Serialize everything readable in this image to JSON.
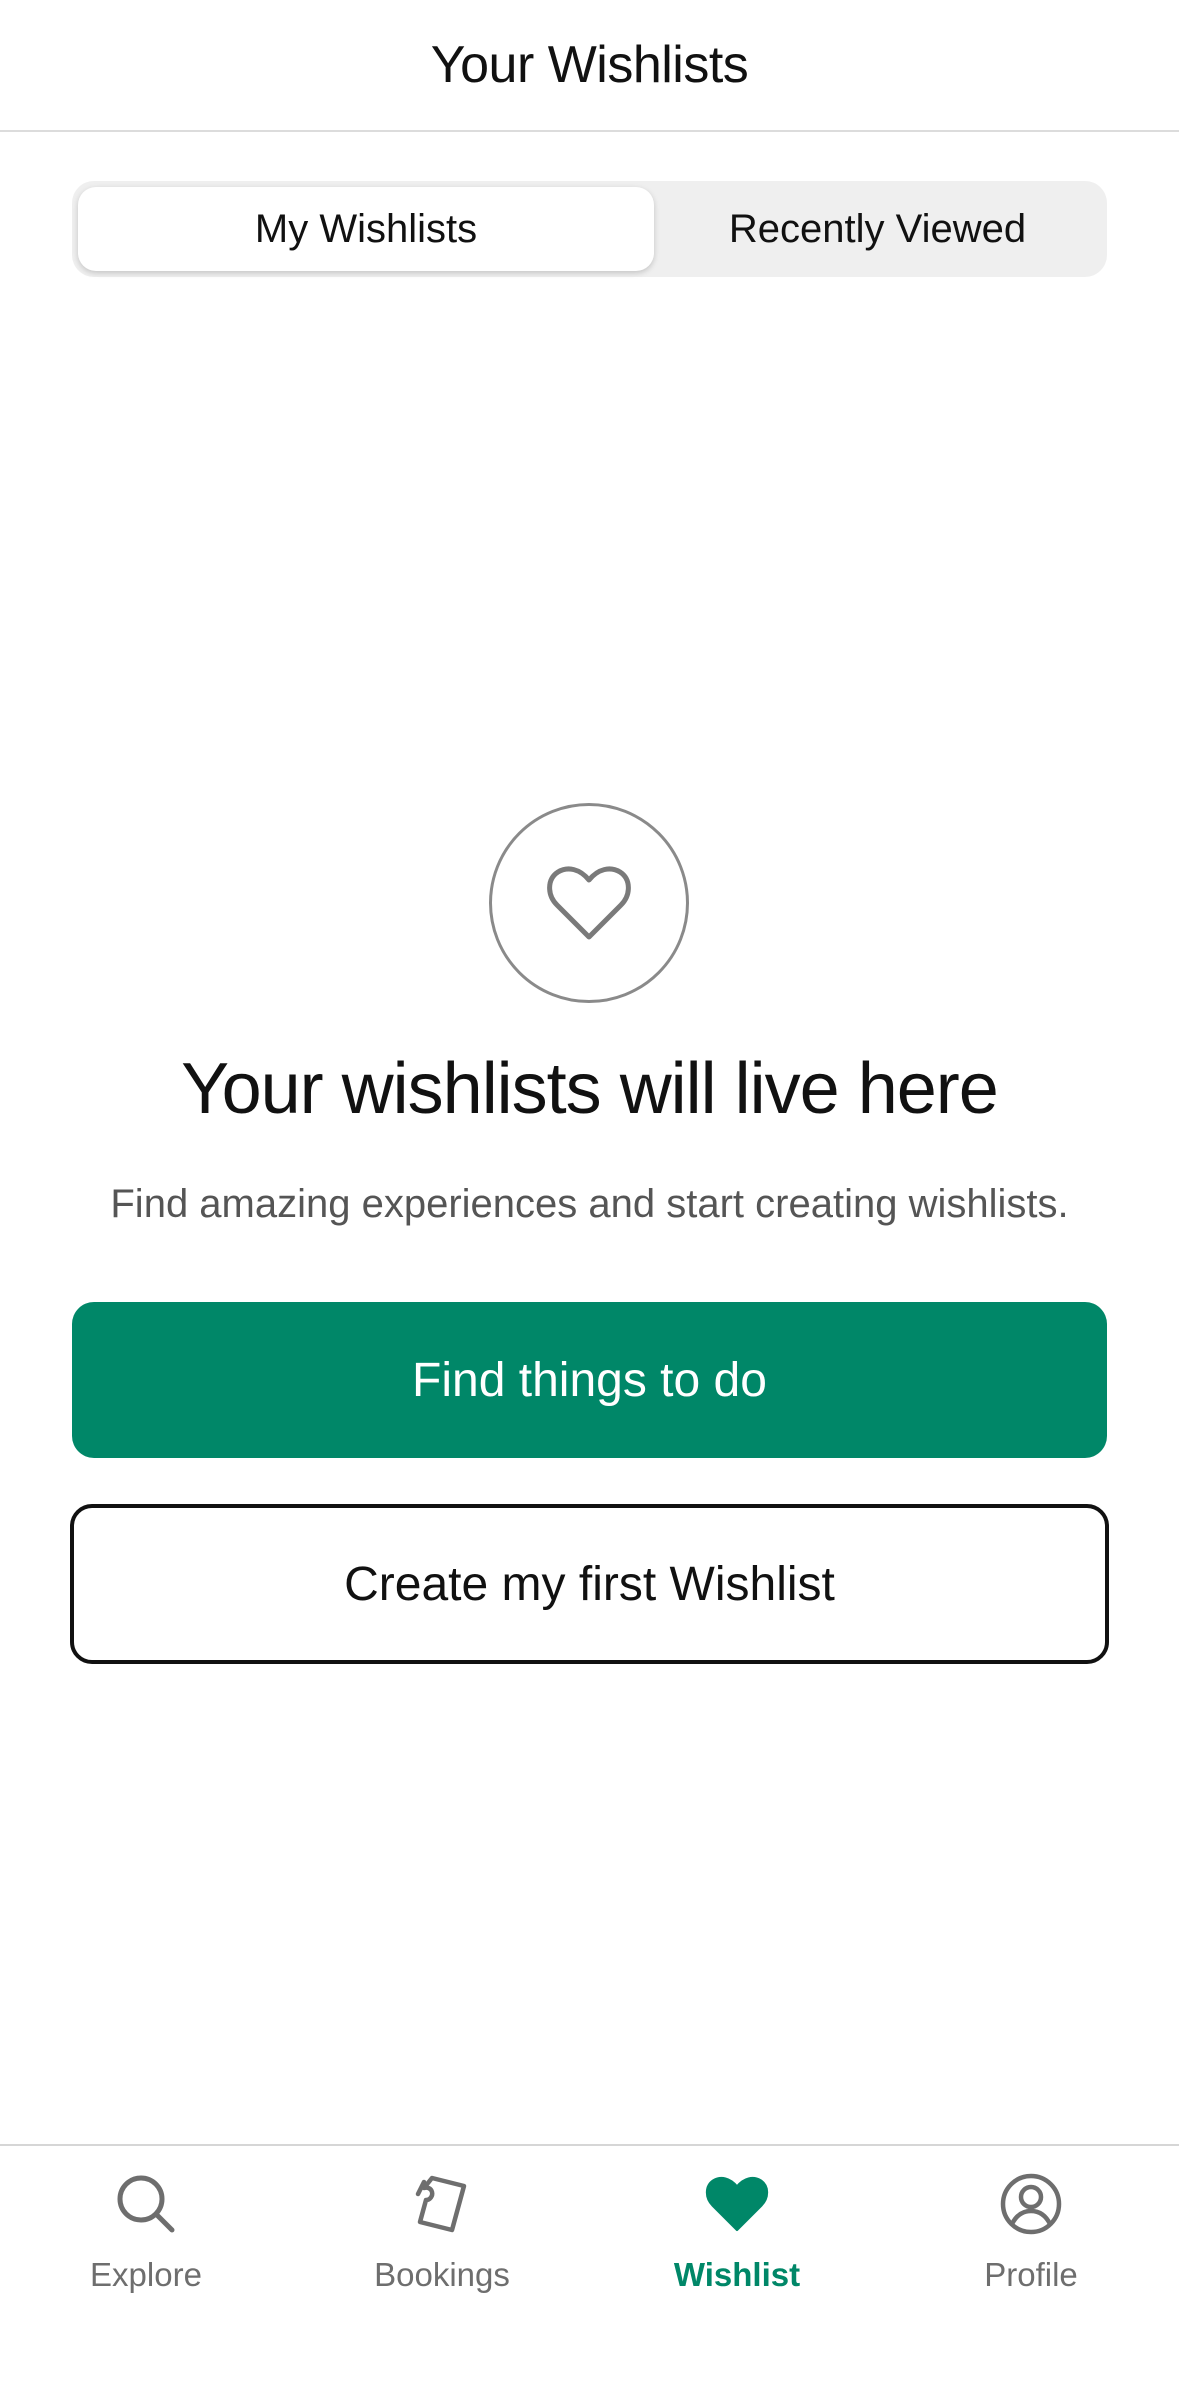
{
  "header": {
    "title": "Your Wishlists"
  },
  "segments": {
    "active": "My Wishlists",
    "inactive": "Recently Viewed"
  },
  "empty_state": {
    "icon": "heart-outline-icon",
    "title": "Your wishlists will live here",
    "subtitle": "Find amazing experiences and start creating wishlists."
  },
  "actions": {
    "primary_label": "Find things to do",
    "secondary_label": "Create my first Wishlist"
  },
  "tabbar": {
    "items": [
      {
        "label": "Explore",
        "icon": "search-icon"
      },
      {
        "label": "Bookings",
        "icon": "ticket-icon"
      },
      {
        "label": "Wishlist",
        "icon": "heart-icon",
        "active": true
      },
      {
        "label": "Profile",
        "icon": "profile-icon"
      }
    ]
  },
  "colors": {
    "accent": "#008768",
    "text": "#111111",
    "muted": "#6e6e6e"
  }
}
